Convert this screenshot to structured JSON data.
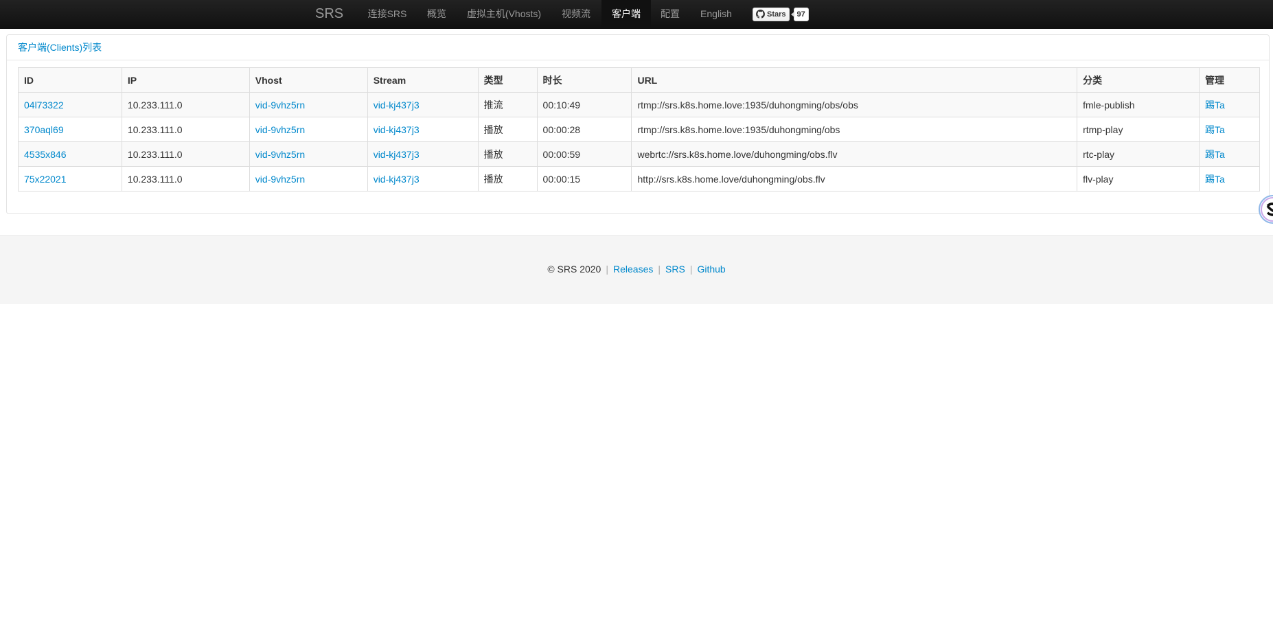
{
  "navbar": {
    "brand": "SRS",
    "items": [
      {
        "label": "连接SRS",
        "active": false
      },
      {
        "label": "概览",
        "active": false
      },
      {
        "label": "虚拟主机(Vhosts)",
        "active": false
      },
      {
        "label": "视频流",
        "active": false
      },
      {
        "label": "客户端",
        "active": true
      },
      {
        "label": "配置",
        "active": false
      },
      {
        "label": "English",
        "active": false
      }
    ],
    "github": {
      "stars_label": "Stars",
      "stars_count": "97",
      "icon": "github-icon"
    }
  },
  "panel": {
    "title": "客户端(Clients)列表"
  },
  "table": {
    "headers": [
      "ID",
      "IP",
      "Vhost",
      "Stream",
      "类型",
      "时长",
      "URL",
      "分类",
      "管理"
    ],
    "rows": [
      {
        "id": "04l73322",
        "ip": "10.233.111.0",
        "vhost": "vid-9vhz5rn",
        "stream": "vid-kj437j3",
        "type": "推流",
        "duration": "00:10:49",
        "url": "rtmp://srs.k8s.home.love:1935/duhongming/obs/obs",
        "category": "fmle-publish",
        "action": "踢Ta"
      },
      {
        "id": "370aql69",
        "ip": "10.233.111.0",
        "vhost": "vid-9vhz5rn",
        "stream": "vid-kj437j3",
        "type": "播放",
        "duration": "00:00:28",
        "url": "rtmp://srs.k8s.home.love:1935/duhongming/obs",
        "category": "rtmp-play",
        "action": "踢Ta"
      },
      {
        "id": "4535x846",
        "ip": "10.233.111.0",
        "vhost": "vid-9vhz5rn",
        "stream": "vid-kj437j3",
        "type": "播放",
        "duration": "00:00:59",
        "url": "webrtc://srs.k8s.home.love/duhongming/obs.flv",
        "category": "rtc-play",
        "action": "踢Ta"
      },
      {
        "id": "75x22021",
        "ip": "10.233.111.0",
        "vhost": "vid-9vhz5rn",
        "stream": "vid-kj437j3",
        "type": "播放",
        "duration": "00:00:15",
        "url": "http://srs.k8s.home.love/duhongming/obs.flv",
        "category": "flv-play",
        "action": "踢Ta"
      }
    ]
  },
  "footer": {
    "copyright": "© SRS 2020",
    "separator": "|",
    "links": [
      "Releases",
      "SRS",
      "Github"
    ]
  },
  "colors": {
    "link": "#0088cc",
    "navbar_bg": "#1b1b1b",
    "nav_text": "#999999",
    "nav_active_text": "#ffffff",
    "footer_bg": "#f5f5f5"
  }
}
